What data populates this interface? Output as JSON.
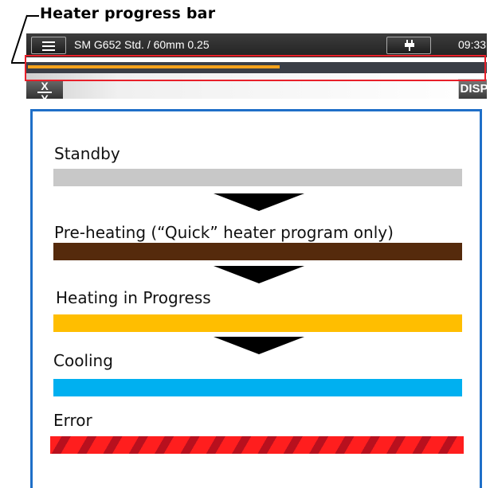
{
  "callout": {
    "label": "Heater progress bar"
  },
  "device": {
    "menu_icon": "hamburger-menu-icon",
    "title": "SM G652 Std. / 60mm 0.25",
    "power_icon": "plug-icon",
    "time": "09:33",
    "heater_progress": 0.55,
    "xy_button": {
      "top": "X",
      "bottom": "Y"
    },
    "disp_button": "DISP"
  },
  "legend": {
    "states": [
      {
        "label": "Standby",
        "color": "#c8c8c8"
      },
      {
        "label": "Pre-heating (“Quick” heater program only)",
        "color": "#552a0c"
      },
      {
        "label": "Heating in Progress",
        "color": "#ffbe00"
      },
      {
        "label": "Cooling",
        "color": "#00b0f0"
      },
      {
        "label": "Error",
        "color": "#ff1e1e"
      }
    ],
    "colors": {
      "border": "#1f6fc8",
      "highlight": "#e8202a"
    }
  }
}
